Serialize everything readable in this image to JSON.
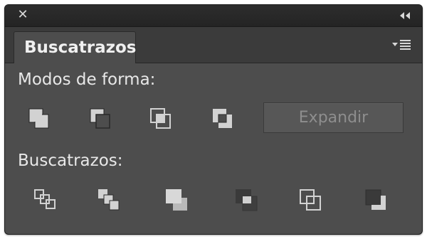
{
  "tab": {
    "label": "Buscatrazos"
  },
  "shape_modes": {
    "label": "Modos de forma:",
    "buttons": [
      {
        "icon": "unite-icon"
      },
      {
        "icon": "minus-front-icon"
      },
      {
        "icon": "intersect-icon"
      },
      {
        "icon": "exclude-icon"
      }
    ],
    "expand_label": "Expandir"
  },
  "pathfinders": {
    "label": "Buscatrazos:",
    "buttons": [
      {
        "icon": "divide-icon"
      },
      {
        "icon": "trim-icon"
      },
      {
        "icon": "merge-icon"
      },
      {
        "icon": "crop-icon"
      },
      {
        "icon": "outline-icon"
      },
      {
        "icon": "minus-back-icon"
      }
    ]
  },
  "colors": {
    "panel": "#4d4d4d",
    "titlebar": "#242424",
    "icon_light": "#d8d8d8",
    "icon_dark": "#2a2a2a"
  }
}
